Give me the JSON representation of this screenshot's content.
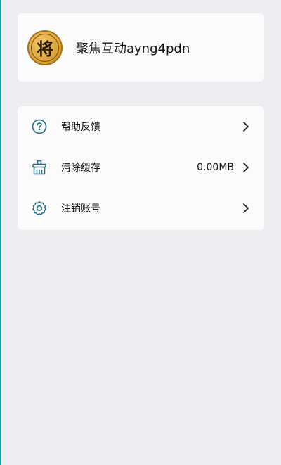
{
  "profile": {
    "avatar_char": "将",
    "username": "聚焦互动ayng4pdn"
  },
  "menu": {
    "items": [
      {
        "label": "帮助反馈",
        "icon": "help-circle-icon",
        "value": ""
      },
      {
        "label": "清除缓存",
        "icon": "broom-icon",
        "value": "0.00MB"
      },
      {
        "label": "注销账号",
        "icon": "gear-icon",
        "value": ""
      }
    ]
  },
  "colors": {
    "background": "#eceef2",
    "card": "#fbfbfb",
    "icon_accent": "#1f6b86",
    "edge_accent": "#1e9bb0"
  }
}
